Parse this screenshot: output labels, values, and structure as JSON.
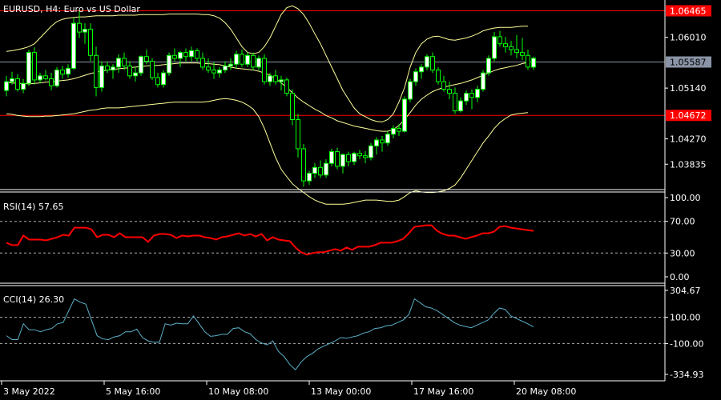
{
  "chart_data": [
    {
      "type": "candlestick",
      "title": "EURUSD, H4:  Euro vs US Dollar",
      "symbol": "EURUSD",
      "timeframe": "H4",
      "description": "Euro vs US Dollar",
      "ylim": [
        1.034,
        1.0665
      ],
      "y_ticks": [
        "1.06465",
        "1.06010",
        "1.05587",
        "1.05140",
        "1.04672",
        "1.04270",
        "1.03835"
      ],
      "horizontal_lines": [
        {
          "label": "1.06465",
          "value": 1.06465,
          "color": "#ff0000"
        },
        {
          "label": "1.05587",
          "value": 1.05587,
          "color": "#8a94a6"
        },
        {
          "label": "1.04672",
          "value": 1.04672,
          "color": "#ff0000"
        }
      ],
      "colors": {
        "bull": "#ffffff",
        "bear": "#000000",
        "outline": "#00ff00",
        "bands": "#ffff99"
      },
      "candles": [
        [
          1.051,
          1.0535,
          1.05,
          1.0525
        ],
        [
          1.0525,
          1.0542,
          1.052,
          1.053
        ],
        [
          1.053,
          1.0538,
          1.0508,
          1.0512
        ],
        [
          1.0512,
          1.053,
          1.0505,
          1.0522
        ],
        [
          1.0522,
          1.058,
          1.0518,
          1.0575
        ],
        [
          1.0575,
          1.0584,
          1.052,
          1.0528
        ],
        [
          1.0528,
          1.054,
          1.0522,
          1.0535
        ],
        [
          1.0535,
          1.0545,
          1.0527,
          1.053
        ],
        [
          1.053,
          1.054,
          1.051,
          1.0518
        ],
        [
          1.0518,
          1.055,
          1.0515,
          1.0545
        ],
        [
          1.0545,
          1.0552,
          1.053,
          1.0538
        ],
        [
          1.0538,
          1.0555,
          1.0532,
          1.0548
        ],
        [
          1.0548,
          1.0635,
          1.0545,
          1.0625
        ],
        [
          1.0625,
          1.065,
          1.06,
          1.061
        ],
        [
          1.061,
          1.0625,
          1.059,
          1.0615
        ],
        [
          1.0615,
          1.0625,
          1.056,
          1.057
        ],
        [
          1.057,
          1.0585,
          1.05,
          1.0515
        ],
        [
          1.0515,
          1.056,
          1.0508,
          1.0552
        ],
        [
          1.0552,
          1.056,
          1.054,
          1.0545
        ],
        [
          1.0545,
          1.0555,
          1.053,
          1.055
        ],
        [
          1.055,
          1.0572,
          1.054,
          1.0565
        ],
        [
          1.0565,
          1.0575,
          1.0545,
          1.0552
        ],
        [
          1.0552,
          1.056,
          1.053,
          1.0535
        ],
        [
          1.0535,
          1.055,
          1.0525,
          1.054
        ],
        [
          1.054,
          1.057,
          1.0535,
          1.0568
        ],
        [
          1.0568,
          1.058,
          1.0555,
          1.056
        ],
        [
          1.056,
          1.0565,
          1.0528,
          1.0532
        ],
        [
          1.0532,
          1.054,
          1.0515,
          1.052
        ],
        [
          1.052,
          1.0545,
          1.0515,
          1.054
        ],
        [
          1.054,
          1.0575,
          1.0535,
          1.057
        ],
        [
          1.057,
          1.0582,
          1.056,
          1.0565
        ],
        [
          1.0565,
          1.0578,
          1.055,
          1.0575
        ],
        [
          1.0575,
          1.0582,
          1.056,
          1.0568
        ],
        [
          1.0568,
          1.0585,
          1.056,
          1.0578
        ],
        [
          1.0578,
          1.0582,
          1.056,
          1.0565
        ],
        [
          1.0565,
          1.0575,
          1.0545,
          1.055
        ],
        [
          1.055,
          1.0565,
          1.054,
          1.0545
        ],
        [
          1.0545,
          1.0558,
          1.053,
          1.054
        ],
        [
          1.054,
          1.055,
          1.0532,
          1.0545
        ],
        [
          1.0545,
          1.056,
          1.054,
          1.0552
        ],
        [
          1.0552,
          1.0565,
          1.0545,
          1.0555
        ],
        [
          1.0555,
          1.0578,
          1.0548,
          1.0572
        ],
        [
          1.0572,
          1.058,
          1.055,
          1.0555
        ],
        [
          1.0555,
          1.0575,
          1.055,
          1.057
        ],
        [
          1.057,
          1.0575,
          1.0545,
          1.055
        ],
        [
          1.055,
          1.057,
          1.0545,
          1.0565
        ],
        [
          1.0565,
          1.0572,
          1.052,
          1.0525
        ],
        [
          1.0525,
          1.054,
          1.0518,
          1.0535
        ],
        [
          1.0535,
          1.0545,
          1.052,
          1.0525
        ],
        [
          1.0525,
          1.0535,
          1.051,
          1.0528
        ],
        [
          1.0528,
          1.0532,
          1.05,
          1.0505
        ],
        [
          1.0505,
          1.0512,
          1.045,
          1.046
        ],
        [
          1.046,
          1.047,
          1.0395,
          1.041
        ],
        [
          1.041,
          1.0418,
          1.0345,
          1.0355
        ],
        [
          1.0355,
          1.0372,
          1.0348,
          1.0368
        ],
        [
          1.0368,
          1.0385,
          1.036,
          1.0378
        ],
        [
          1.0378,
          1.039,
          1.036,
          1.0365
        ],
        [
          1.0365,
          1.0392,
          1.036,
          1.0385
        ],
        [
          1.0385,
          1.041,
          1.038,
          1.0405
        ],
        [
          1.0405,
          1.0412,
          1.0375,
          1.038
        ],
        [
          1.038,
          1.0402,
          1.0368,
          1.04
        ],
        [
          1.04,
          1.0405,
          1.038,
          1.0388
        ],
        [
          1.0388,
          1.0405,
          1.0382,
          1.0402
        ],
        [
          1.0402,
          1.0408,
          1.0392,
          1.0398
        ],
        [
          1.0398,
          1.0406,
          1.0385,
          1.0395
        ],
        [
          1.0395,
          1.042,
          1.039,
          1.0415
        ],
        [
          1.0415,
          1.043,
          1.04,
          1.0425
        ],
        [
          1.0425,
          1.0432,
          1.0405,
          1.042
        ],
        [
          1.042,
          1.044,
          1.0415,
          1.0435
        ],
        [
          1.0435,
          1.045,
          1.0428,
          1.0445
        ],
        [
          1.0445,
          1.0452,
          1.0432,
          1.044
        ],
        [
          1.044,
          1.05,
          1.0438,
          1.0495
        ],
        [
          1.0495,
          1.053,
          1.049,
          1.0525
        ],
        [
          1.0525,
          1.0548,
          1.0518,
          1.0542
        ],
        [
          1.0542,
          1.0555,
          1.053,
          1.055
        ],
        [
          1.055,
          1.0572,
          1.0545,
          1.0568
        ],
        [
          1.0568,
          1.0575,
          1.054,
          1.0545
        ],
        [
          1.0545,
          1.055,
          1.052,
          1.0525
        ],
        [
          1.0525,
          1.0535,
          1.0508,
          1.0512
        ],
        [
          1.0512,
          1.0525,
          1.0495,
          1.0505
        ],
        [
          1.0505,
          1.0515,
          1.047,
          1.0475
        ],
        [
          1.0475,
          1.0498,
          1.0472,
          1.0492
        ],
        [
          1.0492,
          1.051,
          1.0485,
          1.0505
        ],
        [
          1.0505,
          1.0512,
          1.0478,
          1.0498
        ],
        [
          1.0498,
          1.0518,
          1.049,
          1.0512
        ],
        [
          1.0512,
          1.0545,
          1.0508,
          1.054
        ],
        [
          1.054,
          1.057,
          1.0535,
          1.0565
        ],
        [
          1.0565,
          1.061,
          1.056,
          1.0602
        ],
        [
          1.0602,
          1.0612,
          1.0585,
          1.059
        ],
        [
          1.059,
          1.0602,
          1.0575,
          1.0585
        ],
        [
          1.0585,
          1.0595,
          1.057,
          1.058
        ],
        [
          1.058,
          1.0605,
          1.0565,
          1.0575
        ],
        [
          1.0575,
          1.06,
          1.0562,
          1.057
        ],
        [
          1.057,
          1.058,
          1.0545,
          1.055
        ],
        [
          1.055,
          1.0568,
          1.0545,
          1.0565
        ]
      ],
      "bands": {
        "upper": [
          1.0577,
          1.0578,
          1.058,
          1.0582,
          1.0585,
          1.059,
          1.06,
          1.061,
          1.062,
          1.0628,
          1.0632,
          1.0634,
          1.0635,
          1.0636,
          1.0636,
          1.0637,
          1.0638,
          1.0638,
          1.0638,
          1.0638,
          1.0639,
          1.0639,
          1.0639,
          1.0639,
          1.064,
          1.064,
          1.064,
          1.064,
          1.064,
          1.0641,
          1.0641,
          1.0641,
          1.0641,
          1.0641,
          1.0641,
          1.064,
          1.064,
          1.0638,
          1.0634,
          1.0626,
          1.0615,
          1.06,
          1.0585,
          1.0575,
          1.0573,
          1.0575,
          1.0585,
          1.06,
          1.062,
          1.064,
          1.0652,
          1.0655,
          1.065,
          1.064,
          1.0625,
          1.0607,
          1.059,
          1.057,
          1.055,
          1.053,
          1.051,
          1.0495,
          1.048,
          1.047,
          1.0465,
          1.046,
          1.0457,
          1.0456,
          1.046,
          1.047,
          1.049,
          1.0515,
          1.055,
          1.0575,
          1.059,
          1.0598,
          1.0602,
          1.0603,
          1.06,
          1.0597,
          1.0596,
          1.0598,
          1.06,
          1.0603,
          1.0607,
          1.0612,
          1.0615,
          1.0617,
          1.0618,
          1.0618,
          1.0618,
          1.0619,
          1.062,
          1.062
        ],
        "middle": [
          1.0524,
          1.0523,
          1.0522,
          1.0522,
          1.0521,
          1.0522,
          1.0523,
          1.0524,
          1.0525,
          1.0526,
          1.0527,
          1.0528,
          1.053,
          1.0533,
          1.0536,
          1.0539,
          1.0541,
          1.0543,
          1.0545,
          1.0546,
          1.0547,
          1.0548,
          1.0549,
          1.055,
          1.0551,
          1.0552,
          1.0553,
          1.0553,
          1.0554,
          1.0555,
          1.0556,
          1.0557,
          1.0557,
          1.0557,
          1.0557,
          1.0556,
          1.0556,
          1.0555,
          1.0554,
          1.0552,
          1.055,
          1.0548,
          1.0547,
          1.0546,
          1.0545,
          1.0543,
          1.054,
          1.0536,
          1.053,
          1.0523,
          1.0515,
          1.0506,
          1.0497,
          1.049,
          1.0484,
          1.0478,
          1.0473,
          1.0467,
          1.0463,
          1.0458,
          1.0455,
          1.0452,
          1.0449,
          1.0447,
          1.0445,
          1.0443,
          1.0441,
          1.044,
          1.044,
          1.0443,
          1.045,
          1.046,
          1.0472,
          1.0485,
          1.0495,
          1.0502,
          1.0508,
          1.0512,
          1.0515,
          1.0518,
          1.052,
          1.0522,
          1.0525,
          1.0528,
          1.0532,
          1.0536,
          1.054,
          1.0544,
          1.0547,
          1.0549,
          1.0551,
          1.0553,
          1.0556,
          1.0558
        ],
        "lower": [
          1.047,
          1.0469,
          1.0467,
          1.0466,
          1.0465,
          1.0465,
          1.0465,
          1.0466,
          1.0466,
          1.0467,
          1.0468,
          1.0469,
          1.047,
          1.0472,
          1.0474,
          1.0476,
          1.0477,
          1.0479,
          1.048,
          1.048,
          1.048,
          1.0481,
          1.0482,
          1.0483,
          1.0484,
          1.0485,
          1.0486,
          1.0487,
          1.0488,
          1.0489,
          1.049,
          1.049,
          1.049,
          1.049,
          1.049,
          1.049,
          1.0491,
          1.0493,
          1.0495,
          1.0496,
          1.0495,
          1.0493,
          1.049,
          1.0485,
          1.0478,
          1.0465,
          1.0445,
          1.042,
          1.0395,
          1.0375,
          1.0362,
          1.035,
          1.0342,
          1.0335,
          1.0328,
          1.0322,
          1.0318,
          1.0315,
          1.0315,
          1.0315,
          1.0315,
          1.0316,
          1.0318,
          1.032,
          1.0322,
          1.0322,
          1.0322,
          1.0321,
          1.032,
          1.032,
          1.0322,
          1.0328,
          1.0335,
          1.0338,
          1.0336,
          1.0335,
          1.0335,
          1.0336,
          1.0338,
          1.0342,
          1.0348,
          1.036,
          1.0375,
          1.039,
          1.0405,
          1.042,
          1.0432,
          1.0445,
          1.0455,
          1.0462,
          1.0468,
          1.047,
          1.0471,
          1.0472
        ]
      }
    },
    {
      "type": "line",
      "title": "RSI(14) 57.65",
      "ylim": [
        0,
        100
      ],
      "y_ticks": [
        "100.00",
        "70.00",
        "30.00",
        "0.00"
      ],
      "levels": [
        70,
        30
      ],
      "color": "#ff0000",
      "series": [
        {
          "values": [
            43,
            40,
            40,
            52,
            47,
            47,
            47,
            46,
            48,
            50,
            53,
            52,
            62,
            62,
            62,
            60,
            50,
            53,
            53,
            50,
            55,
            50,
            50,
            50,
            50,
            44,
            52,
            54,
            54,
            53,
            49,
            52,
            51,
            52,
            52,
            50,
            49,
            47,
            50,
            51,
            53,
            55,
            52,
            54,
            51,
            54,
            46,
            50,
            47,
            46,
            45,
            37,
            31,
            28,
            30,
            31,
            31,
            33,
            35,
            33,
            37,
            34,
            38,
            38,
            38,
            40,
            43,
            43,
            43,
            45,
            48,
            55,
            63,
            64,
            65,
            65,
            58,
            54,
            52,
            52,
            50,
            48,
            50,
            52,
            55,
            55,
            57,
            63,
            64,
            62,
            61,
            60,
            59,
            58
          ]
        }
      ]
    },
    {
      "type": "line",
      "title": "CCI(14) 26.30",
      "ylim": [
        -334.93,
        304.67
      ],
      "y_ticks": [
        "304.67",
        "100.00",
        "-100.00",
        "-334.93"
      ],
      "levels": [
        100,
        -100
      ],
      "color": "#5bb0c8",
      "series": [
        {
          "values": [
            -40,
            -70,
            -70,
            50,
            5,
            5,
            -10,
            5,
            15,
            50,
            60,
            150,
            240,
            215,
            200,
            80,
            -40,
            -65,
            -70,
            -50,
            -40,
            -10,
            -10,
            10,
            -55,
            -80,
            -90,
            -90,
            50,
            40,
            55,
            50,
            50,
            110,
            50,
            -10,
            -45,
            -40,
            -30,
            -30,
            15,
            20,
            -10,
            -25,
            -70,
            -95,
            -110,
            -80,
            -160,
            -200,
            -260,
            -300,
            -240,
            -200,
            -175,
            -140,
            -120,
            -100,
            -80,
            -55,
            -60,
            -50,
            -40,
            -20,
            -10,
            15,
            20,
            35,
            40,
            60,
            80,
            120,
            240,
            210,
            180,
            170,
            150,
            120,
            90,
            60,
            40,
            30,
            20,
            40,
            60,
            80,
            130,
            170,
            160,
            110,
            90,
            70,
            50,
            26
          ]
        }
      ]
    }
  ],
  "x_axis": {
    "labels": [
      "3 May 2022",
      "5 May 16:00",
      "10 May 08:00",
      "13 May 00:00",
      "17 May 16:00",
      "20 May 08:00"
    ]
  }
}
